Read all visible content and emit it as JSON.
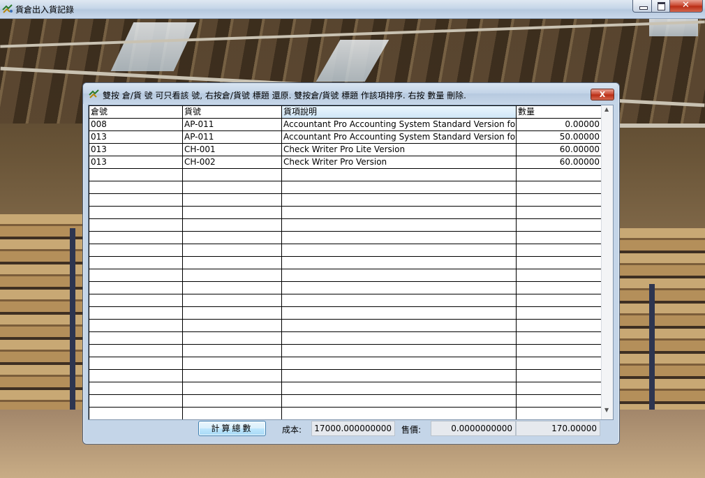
{
  "window": {
    "title": "貨倉出入貨記錄"
  },
  "dialog": {
    "instruction": "雙按 倉/貨 號 可只看該 號, 右按倉/貨號 標題 還原. 雙按倉/貨號 標題 作該項排序. 右按 數量 刪除.",
    "close_label": "X"
  },
  "table": {
    "columns": [
      "倉號",
      "貨號",
      "貨項說明",
      "數量"
    ],
    "rows": [
      [
        "008",
        "AP-011",
        "Accountant Pro Accounting System Standard Version for 單用戶",
        "0.00000"
      ],
      [
        "013",
        "AP-011",
        "Accountant Pro Accounting System Standard Version for 單用戶",
        "50.00000"
      ],
      [
        "013",
        "CH-001",
        "Check Writer Pro Lite Version",
        "60.00000"
      ],
      [
        "013",
        "CH-002",
        "Check Writer Pro Version",
        "60.00000"
      ]
    ]
  },
  "footer": {
    "calc_button": "計算總數",
    "cost_label": "成本:",
    "cost_value": "17000.000000000",
    "price_label": "售價:",
    "price_value": "0.0000000000",
    "qty_total": "170.00000"
  }
}
